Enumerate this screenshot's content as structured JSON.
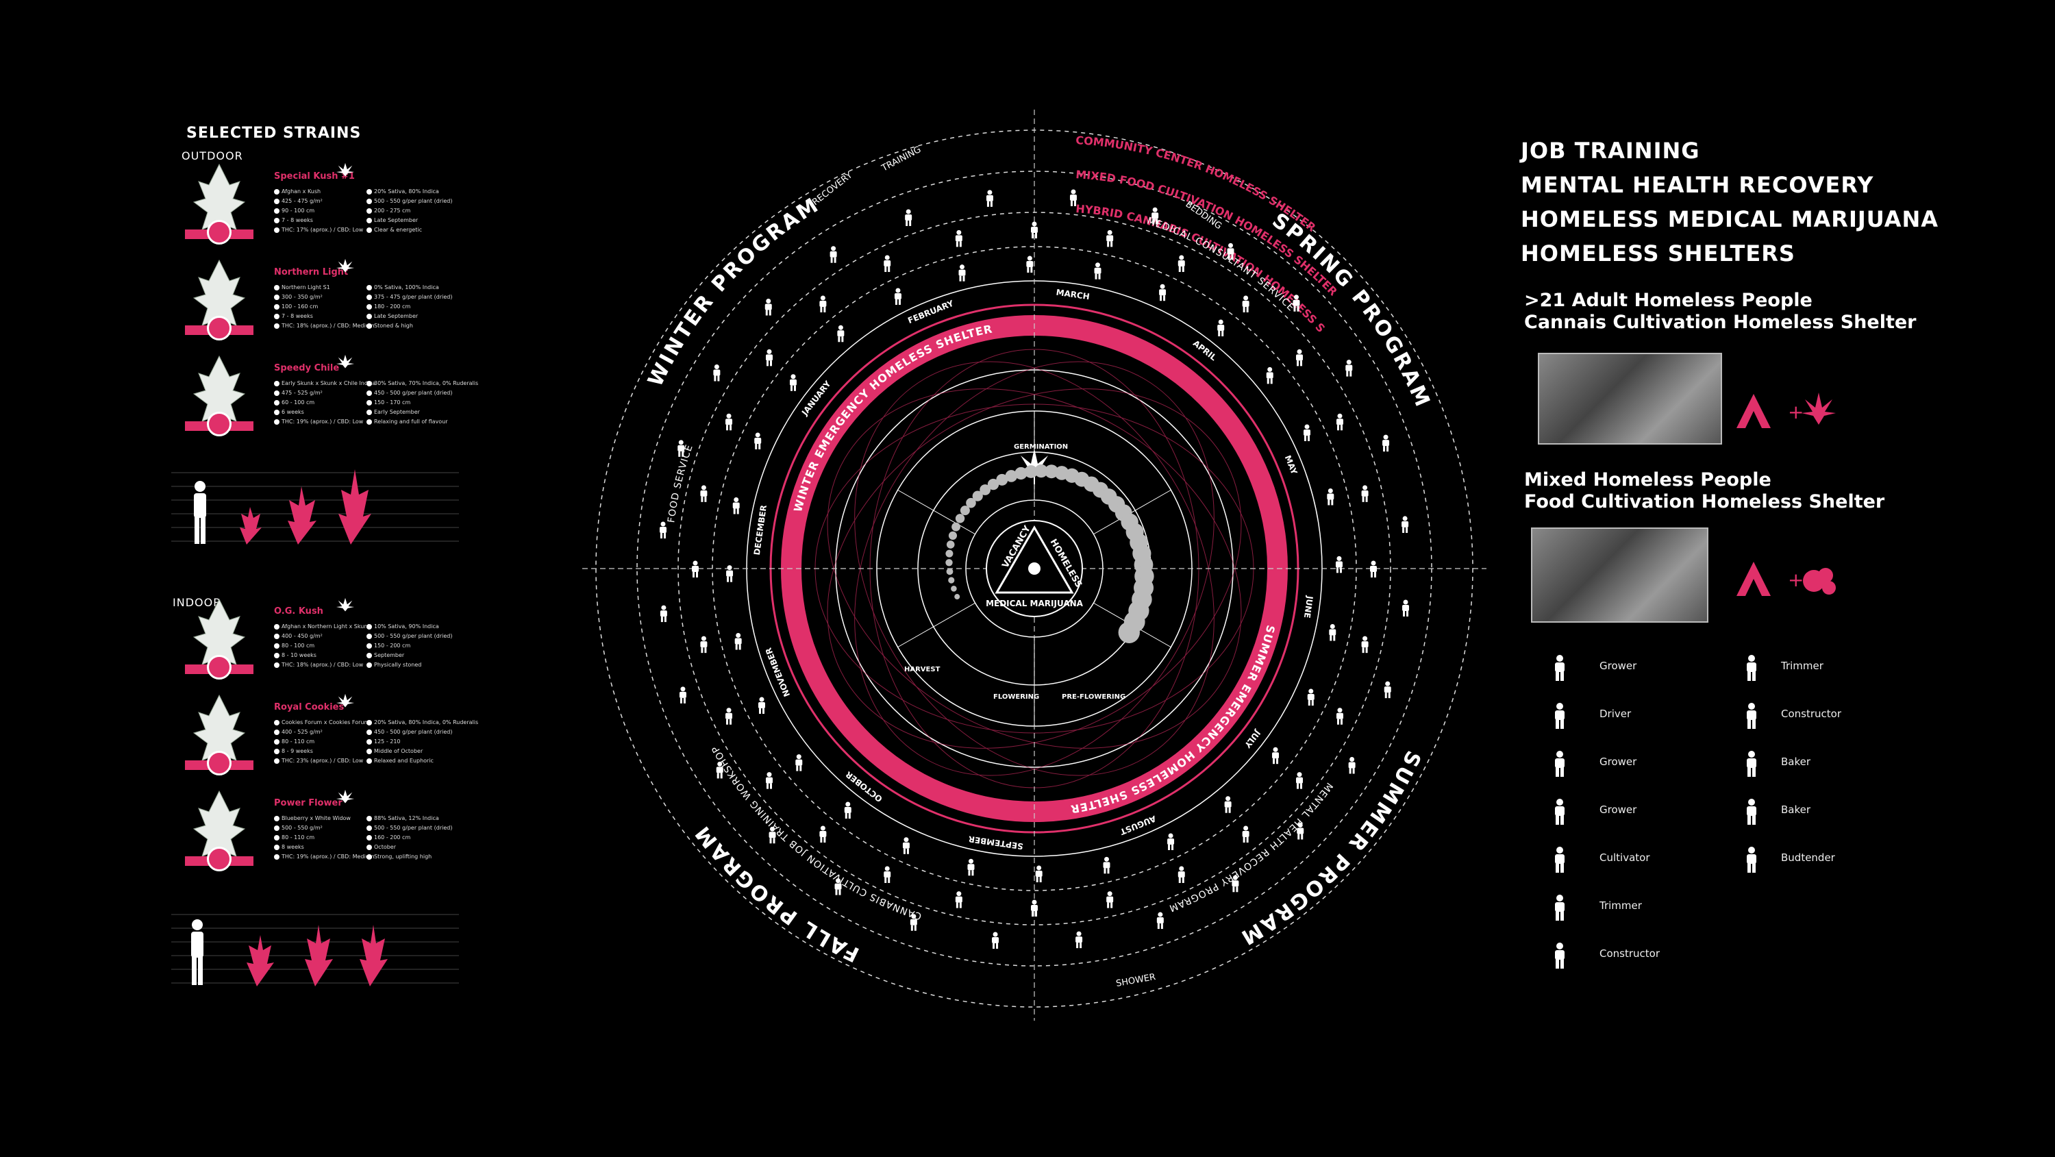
{
  "left_panel": {
    "title": "SELECTED STRAINS",
    "outdoor_label": "OUTDOOR",
    "indoor_label": "INDOOR",
    "strains": [
      {
        "name": "Special Kush #1",
        "specs_a": [
          "Afghan x Kush",
          "425 - 475 g/m²",
          "90 - 100 cm",
          "7 - 8 weeks",
          "THC: 17% (aprox.) / CBD: Low"
        ],
        "specs_b": [
          "20% Sativa, 80% Indica",
          "500 - 550 g/per plant (dried)",
          "200 - 275 cm",
          "Late September",
          "Clear & energetic"
        ]
      },
      {
        "name": "Northern Light",
        "specs_a": [
          "Northern Light S1",
          "300 - 350 g/m²",
          "100 - 160 cm",
          "7 - 8 weeks",
          "THC: 18% (aprox.) / CBD: Medium"
        ],
        "specs_b": [
          "0% Sativa, 100% Indica",
          "375 - 475 g/per plant (dried)",
          "180 - 200 cm",
          "Late September",
          "Stoned & high"
        ]
      },
      {
        "name": "Speedy Chile",
        "specs_a": [
          "Early Skunk x Skunk x Chile Indica",
          "475 - 525 g/m²",
          "60 - 100 cm",
          "6 weeks",
          "THC: 19% (aprox.) / CBD: Low"
        ],
        "specs_b": [
          "30% Sativa, 70% Indica, 0% Ruderalis",
          "450 - 500 g/per plant (dried)",
          "150 - 170 cm",
          "Early September",
          "Relaxing and full of flavour"
        ]
      },
      {
        "name": "O.G. Kush",
        "specs_a": [
          "Afghan x Northern Light x Skunk",
          "400 - 450 g/m²",
          "80 - 100 cm",
          "8 - 10 weeks",
          "THC: 18% (aprox.) / CBD: Low"
        ],
        "specs_b": [
          "10% Sativa, 90% Indica",
          "500 - 550 g/per plant (dried)",
          "150 - 200 cm",
          "September",
          "Physically stoned"
        ]
      },
      {
        "name": "Royal Cookies",
        "specs_a": [
          "Cookies Forum x Cookies Forum",
          "400 - 525 g/m²",
          "80 - 110 cm",
          "8 - 9 weeks",
          "THC: 23% (aprox.) / CBD: Low"
        ],
        "specs_b": [
          "20% Sativa, 80% Indica, 0% Ruderalis",
          "450 - 500 g/per plant (dried)",
          "125 - 210",
          "Middle of October",
          "Relaxed and Euphoric"
        ]
      },
      {
        "name": "Power Flower",
        "specs_a": [
          "Blueberry x White Widow",
          "500 - 550 g/m²",
          "80 - 110 cm",
          "8 weeks",
          "THC: 19% (aprox.) / CBD: Medium"
        ],
        "specs_b": [
          "88% Sativa, 12% Indica",
          "500 - 550 g/per plant (dried)",
          "160 - 200 cm",
          "October",
          "Strong, uplifting high"
        ]
      }
    ]
  },
  "center": {
    "program_labels": [
      "WINTER PROGRAM",
      "SPRING PROGRAM",
      "SUMMER PROGRAM",
      "FALL PROGRAM"
    ],
    "shelter_labels": [
      "COMMUNITY CENTER HOMELESS SHELTER",
      "MIXED FOOD CULTIVATION HOMELESS SHELTER",
      "HYBRID CANNABIS CULTIVATION HOMELESS SHELTER"
    ],
    "service_labels": [
      "FOOD SERVICE",
      "MEDICAL CONSULTANT SERVICE",
      "MENTAL HEALTH RECOVERY PROGRAM",
      "CANNABIS CULTIVATION JOB TRAINING WORKSHOP"
    ],
    "emergency_labels": [
      "WINTER EMERGENCY HOMELESS SHELTER",
      "SUMMER EMERGENCY HOMELESS SHELTER"
    ],
    "months": [
      "MARCH",
      "APRIL",
      "MAY",
      "JUNE",
      "JULY",
      "AUGUST",
      "SEPTEMBER",
      "OCTOBER",
      "NOVEMBER",
      "DECEMBER",
      "JANUARY",
      "FEBRUARY"
    ],
    "ring_words": [
      "TRAINING",
      "RECOVERY",
      "BEDDING",
      "SHOWER"
    ],
    "stage_labels": [
      "GERMINATION",
      "FLOWERING",
      "PRE-FLOWERING",
      "HARVEST"
    ],
    "core": {
      "top_left": "VACANCY",
      "top_right": "HOMELESS",
      "bottom": "MEDICAL MARIJUANA"
    }
  },
  "right_panel": {
    "headings": [
      "JOB TRAINING",
      "MENTAL HEALTH RECOVERY",
      "HOMELESS MEDICAL MARIJUANA",
      "HOMELESS SHELTERS"
    ],
    "group1_line1": ">21 Adult Homeless People",
    "group1_line2": "Cannais Cultivation Homeless Shelter",
    "group2_line1": "Mixed Homeless People",
    "group2_line2": "Food Cultivation Homeless Shelter",
    "plus": "+",
    "roles_left": [
      "Grower",
      "Driver",
      "Grower",
      "Grower",
      "Cultivator",
      "Trimmer",
      "Constructor"
    ],
    "roles_right": [
      "Trimmer",
      "Constructor",
      "Baker",
      "Baker",
      "Budtender"
    ]
  },
  "colors": {
    "accent": "#e0306a",
    "background": "#000000",
    "text": "#ffffff"
  }
}
